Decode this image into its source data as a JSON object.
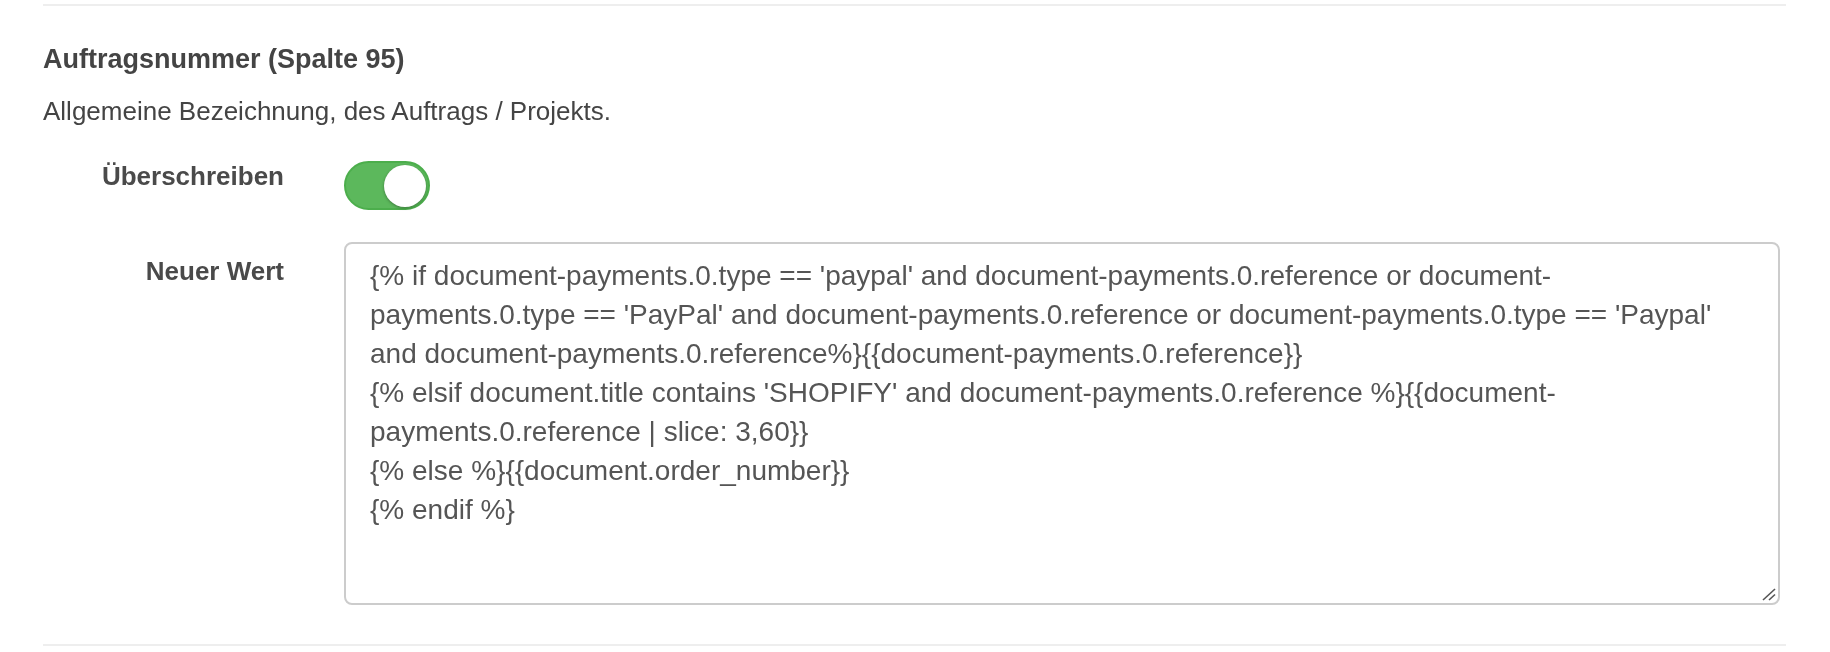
{
  "section": {
    "title": "Auftragsnummer (Spalte 95)",
    "description": "Allgemeine Bezeichnung, des Auftrags / Projekts."
  },
  "fields": [
    {
      "kind": "toggle",
      "label": "Überschreiben",
      "on": true
    },
    {
      "kind": "textarea",
      "label": "Neuer Wert",
      "value": "{% if document-payments.0.type == 'paypal' and document-payments.0.reference or document-payments.0.type == 'PayPal' and document-payments.0.reference or document-payments.0.type == 'Paypal' and document-payments.0.reference%}{{document-payments.0.reference}}\n{% elsif document.title contains 'SHOPIFY' and document-payments.0.reference %}{{document-payments.0.reference | slice: 3,60}}\n{% else %}{{document.order_number}}\n{% endif %}"
    }
  ]
}
